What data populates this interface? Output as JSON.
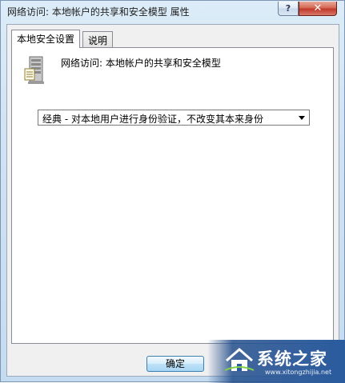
{
  "window": {
    "title": "网络访问: 本地帐户的共享和安全模型 属性",
    "help_label": "?",
    "close_label": "✕"
  },
  "tabs": [
    {
      "label": "本地安全设置",
      "active": true
    },
    {
      "label": "说明",
      "active": false
    }
  ],
  "panel": {
    "icon": "server-icon",
    "policy_name": "网络访问: 本地帐户的共享和安全模型",
    "select_value": "经典 - 对本地用户进行身份验证，不改变其本来身份"
  },
  "buttons": {
    "ok_label": "确定"
  },
  "watermark": {
    "logo": "house-logo",
    "text": "系统之家",
    "url": "www.xitongzhijia.net"
  }
}
